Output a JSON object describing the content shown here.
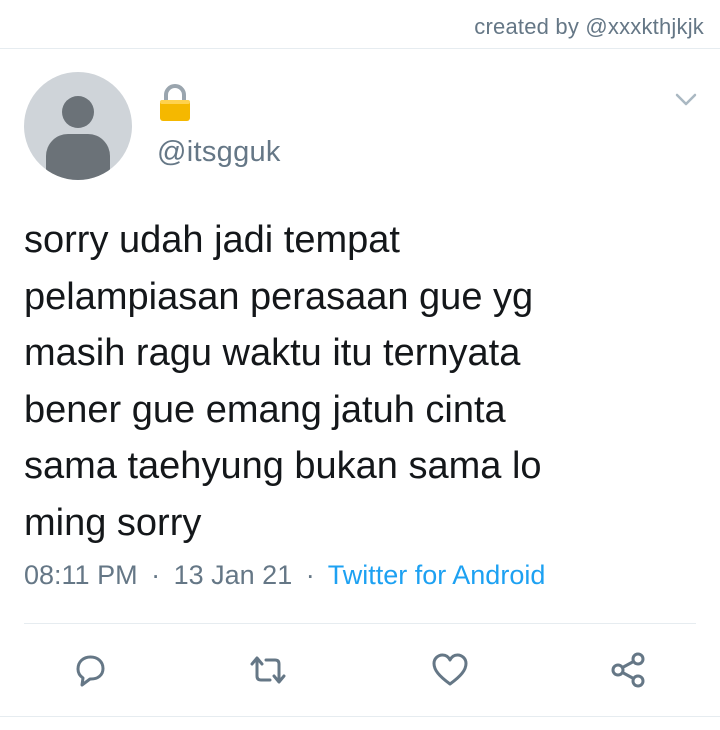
{
  "watermark": {
    "text": "created by @xxxkthjkjk"
  },
  "tweet": {
    "protected_icon": "lock-icon",
    "handle": "@itsgguk",
    "text": "sorry udah jadi tempat\npelampiasan perasaan gue yg\nmasih ragu waktu itu ternyata\nbener gue emang jatuh cinta\nsama taehyung bukan sama lo\nming sorry",
    "time": "08:11 PM",
    "separator": "·",
    "date": "13 Jan 21",
    "source": "Twitter for Android"
  },
  "actions": {
    "reply": "reply-icon",
    "retweet": "retweet-icon",
    "like": "heart-icon",
    "share": "share-icon"
  },
  "colors": {
    "text": "#14171a",
    "muted": "#657786",
    "link": "#1da1f2",
    "divider": "#e6ecf0",
    "lock": "#f5b800"
  }
}
